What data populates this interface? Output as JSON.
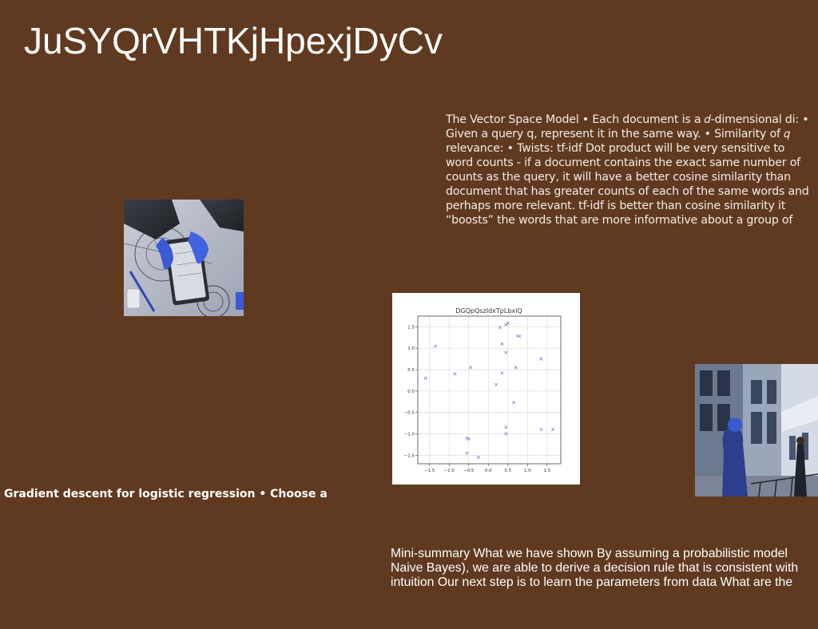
{
  "slide": {
    "title": "JuSYQrVHTKjHpexjDyCv",
    "vector_space_text": "The Vector Space Model • Each document is a 𝑑-dimensional di: • Given a query q, represent it in the same way. • Similarity of 𝑞 relevance: • Twists:  tf-idf Dot product will be very sensitive to word counts - if a document contains the exact same number of counts as the query, it will have a better cosine similarity than document that has greater counts of each of the same words and perhaps more relevant. tf-idf is better than cosine similarity it “boosts” the words that are more informative about a group of",
    "gradient_text": "Gradient descent for logistic regression • Choose a",
    "mini_summary_text": "Mini-summary What we have shown By assuming a probabilistic model Naive Bayes), we are able to derive a decision rule that is consistent with intuition Our next step is to learn the parameters from data What are the"
  },
  "colors": {
    "background": "#603a20",
    "text": "#ffffff",
    "marker": "#8a86c8"
  },
  "icons": {
    "hands_photo": "hands-tablet-photo",
    "street_photo": "street-photo"
  },
  "chart_data": {
    "type": "scatter",
    "title": "DGQpQszIdxTpLbxiQ",
    "marker": "x",
    "xlim": [
      -1.8,
      1.85
    ],
    "ylim": [
      -1.7,
      1.75
    ],
    "xticks": [
      -1.5,
      -1.0,
      -0.5,
      0.0,
      0.5,
      1.0,
      1.5
    ],
    "xtick_labels": [
      "−1.5",
      "−1.0",
      "−0.5",
      "0.0",
      "0.5",
      "1.0",
      "1.5"
    ],
    "yticks": [
      -1.5,
      -1.0,
      -0.5,
      0.0,
      0.5,
      1.0,
      1.5
    ],
    "ytick_labels": [
      "−1.5",
      "−1.0",
      "−0.5",
      "0.0",
      "0.5",
      "1.0",
      "1.5"
    ],
    "grid": true,
    "x": [
      -1.6,
      -1.35,
      -0.85,
      -0.45,
      -0.55,
      -0.5,
      -0.55,
      -0.25,
      0.3,
      0.35,
      0.45,
      0.5,
      0.45,
      0.7,
      0.75,
      0.8,
      0.35,
      0.2,
      0.65,
      1.35,
      0.45,
      0.45,
      1.35,
      1.65
    ],
    "y": [
      0.3,
      1.05,
      0.4,
      0.55,
      -1.1,
      -1.12,
      -1.45,
      -1.55,
      1.48,
      1.1,
      0.9,
      1.58,
      1.55,
      0.55,
      1.28,
      1.28,
      0.42,
      0.15,
      -0.27,
      0.75,
      -0.85,
      -1.0,
      -0.9,
      -0.9
    ]
  }
}
